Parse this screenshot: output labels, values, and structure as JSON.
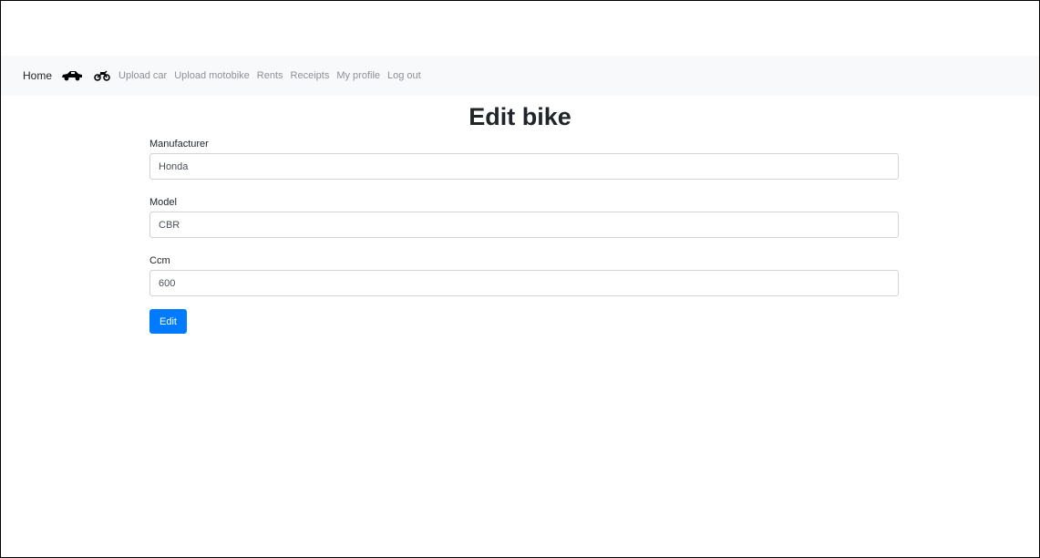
{
  "navbar": {
    "brand": "Home",
    "icons": [
      {
        "name": "car-icon",
        "color": "#000000"
      },
      {
        "name": "motorbike-icon",
        "color": "#000000"
      }
    ],
    "links": [
      "Upload car",
      "Upload motobike",
      "Rents",
      "Receipts",
      "My profile",
      "Log out"
    ]
  },
  "page": {
    "title": "Edit bike"
  },
  "form": {
    "fields": [
      {
        "label": "Manufacturer",
        "value": "Honda"
      },
      {
        "label": "Model",
        "value": "CBR"
      },
      {
        "label": "Ccm",
        "value": "600"
      }
    ],
    "submit_label": "Edit"
  },
  "colors": {
    "primary": "#007bff",
    "navbar_bg": "#f8f9fa",
    "nav_link": "#8c9196"
  }
}
